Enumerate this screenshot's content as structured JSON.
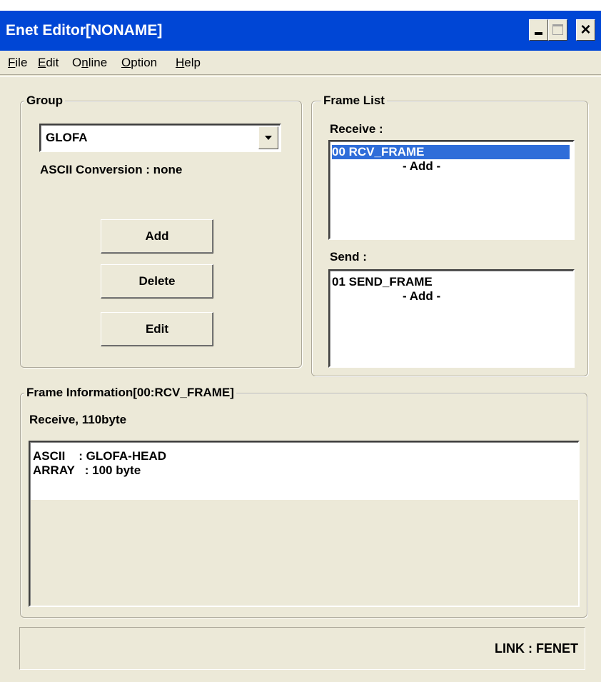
{
  "window": {
    "title": "Enet Editor[NONAME]",
    "controls": {
      "minimize": "_",
      "maximize": "□",
      "close": "×"
    }
  },
  "menu": [
    {
      "accel": "F",
      "rest": "ile"
    },
    {
      "accel": "E",
      "rest": "dit"
    },
    {
      "pre": "O",
      "accel": "n",
      "rest": "line"
    },
    {
      "accel": "O",
      "rest": "ption"
    },
    {
      "accel": "H",
      "rest": "elp"
    }
  ],
  "group": {
    "legend": "Group",
    "selected": "GLOFA",
    "ascii_conversion": "ASCII Conversion : none",
    "buttons": {
      "add": "Add",
      "delete": "Delete",
      "edit": "Edit"
    }
  },
  "frame_list": {
    "legend": "Frame List",
    "receive_label": "Receive :",
    "receive_items": [
      "00 RCV_FRAME",
      "- Add -"
    ],
    "send_label": "Send :",
    "send_items": [
      "01 SEND_FRAME",
      "- Add -"
    ]
  },
  "frame_info": {
    "legend": "Frame Information[00:RCV_FRAME]",
    "summary": "Receive, 110byte",
    "lines": [
      "ASCII    : GLOFA-HEAD",
      "ARRAY   : 100 byte"
    ]
  },
  "status": {
    "link": "LINK : FENET"
  }
}
